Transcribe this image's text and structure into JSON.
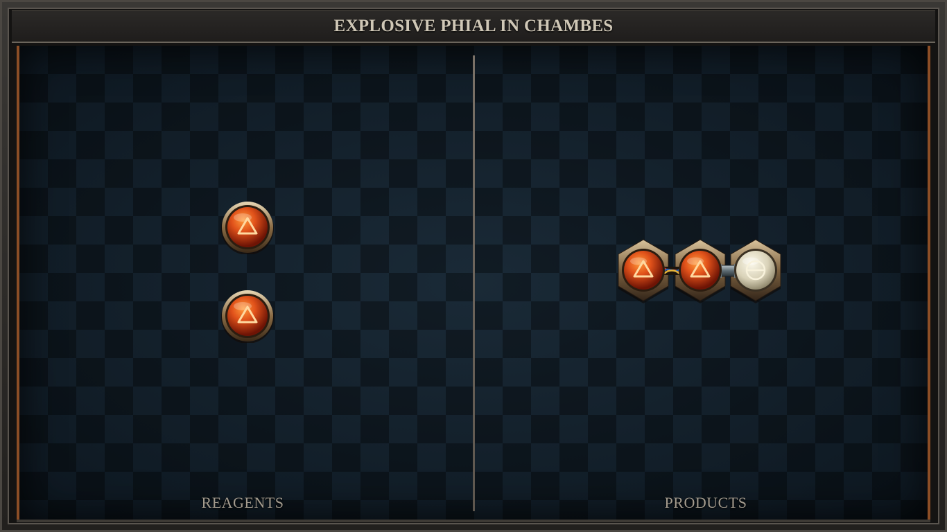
{
  "title": "EXPLOSIVE PHIAL IN CHAMBES",
  "panels": {
    "reagents_label": "REAGENTS",
    "products_label": "PRODUCTS"
  },
  "reagents": [
    {
      "element": "fire",
      "symbol_icon": "triangle-icon",
      "color": "#e0511a"
    },
    {
      "element": "fire",
      "symbol_icon": "triangle-icon",
      "color": "#e0511a"
    }
  ],
  "products": [
    {
      "atoms": [
        {
          "element": "fire",
          "symbol_icon": "triangle-icon",
          "color": "#e0511a"
        },
        {
          "element": "fire",
          "symbol_icon": "triangle-icon",
          "color": "#e0511a"
        },
        {
          "element": "salt",
          "symbol_icon": "circle-bar-icon",
          "color": "#e8e3cf"
        }
      ],
      "bonds": [
        "triplex-bond",
        "single-bond"
      ]
    }
  ],
  "colors": {
    "frame": "#3a3835",
    "board": "#0f1b25",
    "accent_border": "#8c4e26",
    "text": "#cfc7b6"
  }
}
